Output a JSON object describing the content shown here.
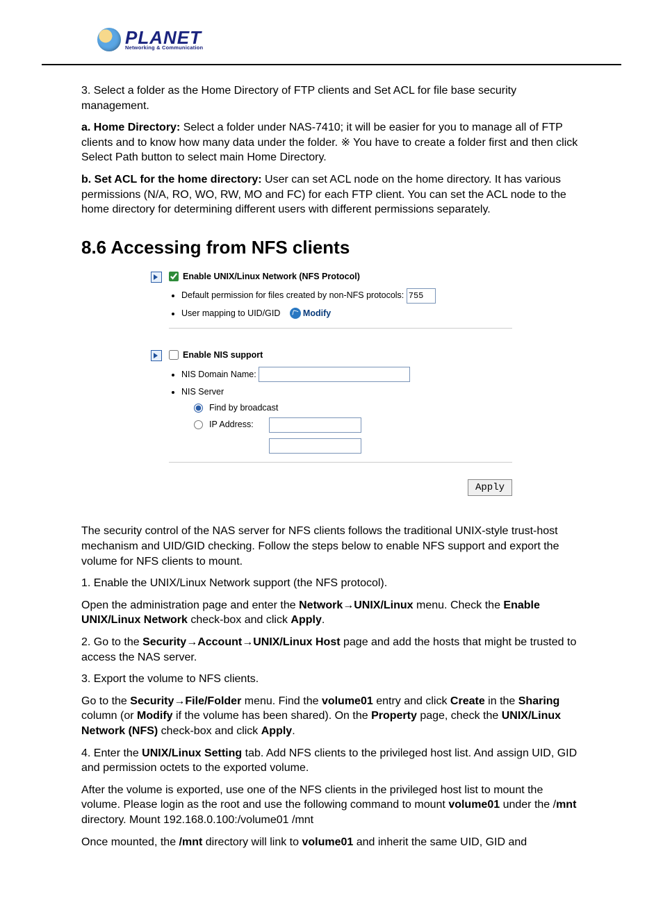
{
  "logo": {
    "brand": "PLANET",
    "tagline": "Networking & Communication"
  },
  "para": {
    "p1": "3. Select a folder as the Home Directory of FTP clients and Set ACL for file base security management.",
    "p2a_b": "a. Home Directory:",
    "p2a": " Select a folder under NAS-7410; it will be easier for you to manage all of FTP clients and to know how many data under the folder. ※ You have to create a folder first and then click Select Path button to select main Home Directory.",
    "p2b_b": "b. Set ACL for the home directory:",
    "p2b": " User can set ACL node on the home directory. It has various permissions (N/A, RO, WO, RW, MO and FC) for each FTP client. You can set the ACL node to the home directory for determining different users with different permissions separately."
  },
  "heading": "8.6 Accessing from NFS clients",
  "panel": {
    "nfs": {
      "enable_label": "Enable UNIX/Linux Network (NFS Protocol)",
      "enable_checked": true,
      "perm_label": "Default permission for files created by non-NFS protocols:",
      "perm_value": "755",
      "uidgid_label": "User mapping to UID/GID",
      "modify_label": "Modify"
    },
    "nis": {
      "enable_label": "Enable NIS support",
      "enable_checked": false,
      "domain_label": "NIS Domain Name:",
      "domain_value": "",
      "server_label": "NIS Server",
      "find_label": "Find by broadcast",
      "ip_label": "IP Address:",
      "ip1": "",
      "ip2": "",
      "selected": "broadcast"
    },
    "apply_label": "Apply"
  },
  "body": {
    "b1": "The security control of the NAS server for NFS clients follows the traditional UNIX-style trust-host mechanism and UID/GID checking. Follow the steps below to enable NFS support and export the volume for NFS clients to mount.",
    "s1": "1. Enable the UNIX/Linux Network support (the NFS protocol).",
    "s1a_pre": "Open the administration page and enter the ",
    "s1a_net": "Network",
    "s1a_unix": "UNIX/Linux",
    "s1a_mid": " menu. Check the ",
    "s1a_en": "Enable UNIX/Linux Network",
    "s1a_post": " check-box and click ",
    "s1a_apply": "Apply",
    "s1a_end": ".",
    "s2_pre": "2. Go to the ",
    "s2_sec": "Security",
    "s2_acc": "Account",
    "s2_host": "UNIX/Linux Host",
    "s2_post": " page and add the hosts that might be trusted to access the NAS server.",
    "s3": "3. Export the volume to NFS clients.",
    "s3a_pre": "Go to the ",
    "s3a_sec": "Security",
    "s3a_ff": "File/Folder",
    "s3a_mid1": " menu. Find the ",
    "s3a_vol": "volume01",
    "s3a_mid2": " entry and click ",
    "s3a_create": "Create",
    "s3a_mid3": " in the ",
    "s3a_sharing": "Sharing",
    "s3a_mid4": " column (or ",
    "s3a_modify": "Modify",
    "s3a_mid5": " if the volume has been shared). On the ",
    "s3a_prop": "Property",
    "s3a_mid6": " page, check the ",
    "s3a_nfs": "UNIX/Linux Network (NFS)",
    "s3a_mid7": " check-box and click ",
    "s3a_apply": "Apply",
    "s3a_end": ".",
    "s4_pre": "4. Enter the ",
    "s4_tab": "UNIX/Linux Setting",
    "s4_post": " tab. Add NFS clients to the privileged host list. And assign UID, GID and permission octets to the exported volume.",
    "s5_pre": "After the volume is exported, use one of the NFS clients in the privileged host list to mount the volume. Please login as the root and use the following command to mount ",
    "s5_vol": "volume01",
    "s5_mid": " under the /",
    "s5_mnt": "mnt",
    "s5_post": " directory. Mount 192.168.0.100:/volume01 /mnt",
    "s6_pre": "Once mounted, the ",
    "s6_mnt": "/mnt",
    "s6_mid": " directory will link to ",
    "s6_vol": "volume01",
    "s6_post": " and inherit the same UID, GID and"
  }
}
